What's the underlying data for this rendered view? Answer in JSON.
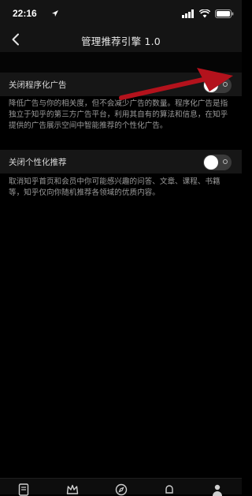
{
  "status_bar": {
    "time": "22:16"
  },
  "nav": {
    "title": "管理推荐引擎 1.0"
  },
  "settings": [
    {
      "label": "关闭程序化广告",
      "enabled": false,
      "description": "降低广告与你的相关度，但不会减少广告的数量。程序化广告是指独立于知乎的第三方广告平台，利用其自有的算法和信息，在知乎提供的广告展示空间中智能推荐的个性化广告。"
    },
    {
      "label": "关闭个性化推荐",
      "enabled": false,
      "description": "取消知乎首页和会员中你可能感兴趣的问答、文章、课程、书籍等，知乎仅向你随机推荐各领域的优质内容。"
    }
  ],
  "colors": {
    "background": "#000000",
    "row_background": "#161616",
    "annotation_arrow": "#b3121c"
  },
  "icons": {
    "status": [
      "location-icon",
      "signal-icon",
      "wifi-icon",
      "battery-icon"
    ],
    "tab_bar": [
      "document-icon",
      "crown-icon",
      "compass-icon",
      "bell-icon",
      "person-icon"
    ]
  }
}
